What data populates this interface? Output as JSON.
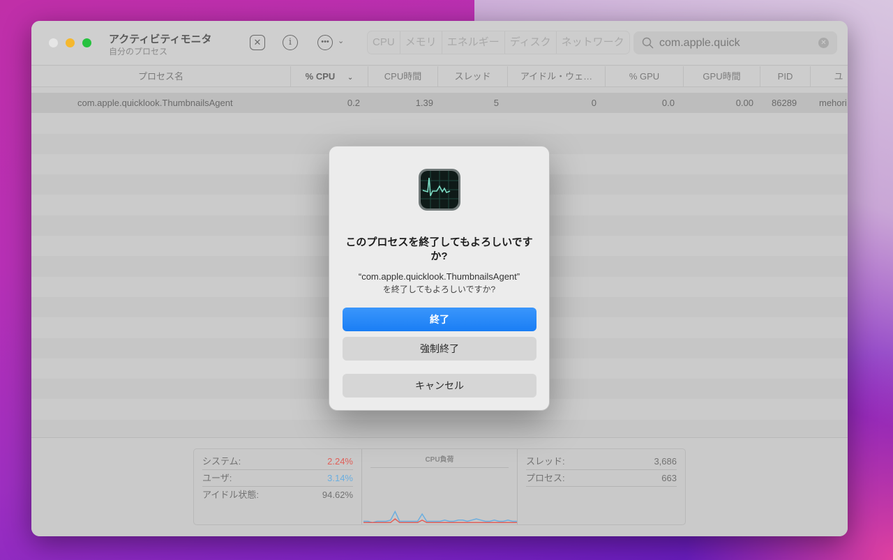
{
  "window": {
    "title": "アクティビティモニタ",
    "subtitle": "自分のプロセス"
  },
  "toolbar": {
    "stop_icon": "stop-process-icon",
    "info_icon": "info-icon",
    "more_icon": "ellipsis-icon",
    "tabs": [
      "CPU",
      "メモリ",
      "エネルギー",
      "ディスク",
      "ネットワーク"
    ],
    "active_tab": "CPU"
  },
  "search": {
    "value": "com.apple.quick"
  },
  "table": {
    "columns": [
      "プロセス名",
      "% CPU",
      "CPU時間",
      "スレッド",
      "アイドル・ウェ…",
      "% GPU",
      "GPU時間",
      "PID",
      "ユ"
    ],
    "rows": [
      [
        "com.apple.quicklook.ThumbnailsAgent",
        "0.2",
        "1.39",
        "5",
        "0",
        "0.0",
        "0.00",
        "86289",
        "mehori"
      ]
    ]
  },
  "footer": {
    "system_label": "システム:",
    "system_value": "2.24%",
    "user_label": "ユーザ:",
    "user_value": "3.14%",
    "idle_label": "アイドル状態:",
    "idle_value": "94.62%",
    "chart_title": "CPU負荷",
    "threads_label": "スレッド:",
    "threads_value": "3,686",
    "processes_label": "プロセス:",
    "processes_value": "663",
    "colors": {
      "system": "#e0605a",
      "user": "#6aaee0"
    },
    "cpu_load_user": [
      2,
      2,
      1,
      2,
      2,
      2,
      3,
      10,
      2,
      2,
      2,
      2,
      2,
      8,
      2,
      2,
      2,
      2,
      3,
      2,
      2,
      3,
      3,
      2,
      3,
      4,
      3,
      2,
      2,
      3,
      2,
      2,
      3,
      2,
      2
    ],
    "cpu_load_system": [
      1,
      1,
      1,
      1,
      1,
      1,
      1,
      4,
      1,
      1,
      1,
      1,
      1,
      3,
      1,
      1,
      1,
      1,
      1,
      1,
      1,
      1,
      1,
      1,
      1,
      1,
      1,
      1,
      1,
      1,
      1,
      1,
      1,
      1,
      1
    ]
  },
  "dialog": {
    "title": "このプロセスを終了してもよろしいですか?",
    "message_line1": "“com.apple.quicklook.ThumbnailsAgent”",
    "message_line2": "を終了してもよろしいですか?",
    "quit": "終了",
    "force_quit": "強制終了",
    "cancel": "キャンセル",
    "accent": "#1a7ef5"
  }
}
